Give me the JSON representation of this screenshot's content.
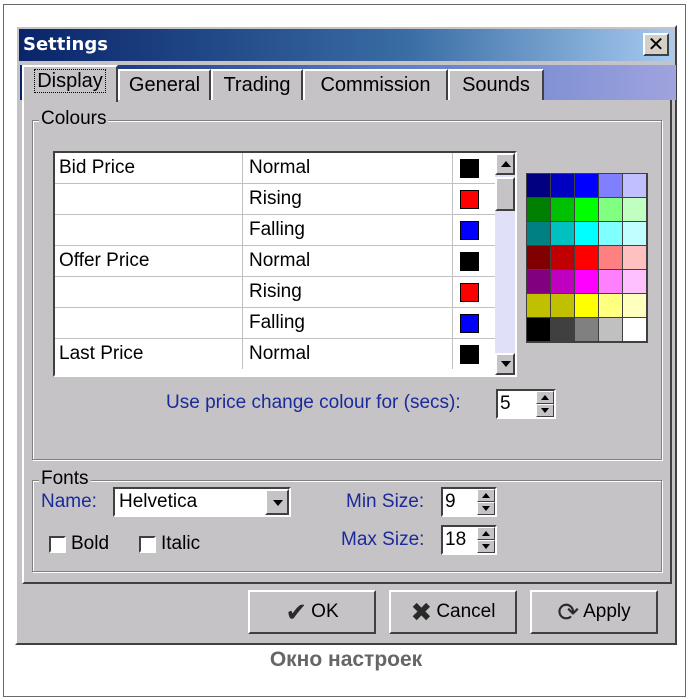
{
  "window": {
    "title": "Settings",
    "close_glyph": "✕"
  },
  "tabs": [
    {
      "label": "Display",
      "active": true
    },
    {
      "label": "General",
      "active": false
    },
    {
      "label": "Trading",
      "active": false
    },
    {
      "label": "Commission",
      "active": false
    },
    {
      "label": "Sounds",
      "active": false
    }
  ],
  "colours": {
    "group_label": "Colours",
    "rows": [
      {
        "item": "Bid Price",
        "state": "Normal",
        "color": "#000000"
      },
      {
        "item": "",
        "state": "Rising",
        "color": "#ff0000"
      },
      {
        "item": "",
        "state": "Falling",
        "color": "#0000ff"
      },
      {
        "item": "Offer Price",
        "state": "Normal",
        "color": "#000000"
      },
      {
        "item": "",
        "state": "Rising",
        "color": "#ff0000"
      },
      {
        "item": "",
        "state": "Falling",
        "color": "#0000ff"
      },
      {
        "item": "Last Price",
        "state": "Normal",
        "color": "#000000"
      }
    ],
    "palette": [
      [
        "#000080",
        "#0000c0",
        "#0000ff",
        "#8080ff",
        "#c0c0ff"
      ],
      [
        "#008000",
        "#00c000",
        "#00ff00",
        "#80ff80",
        "#c0ffc0"
      ],
      [
        "#008080",
        "#00c0c0",
        "#00ffff",
        "#80ffff",
        "#c0ffff"
      ],
      [
        "#800000",
        "#c00000",
        "#ff0000",
        "#ff8080",
        "#ffc0c0"
      ],
      [
        "#800080",
        "#c000c0",
        "#ff00ff",
        "#ff80ff",
        "#ffc0ff"
      ],
      [
        "#c0c000",
        "#c0c000",
        "#ffff00",
        "#ffff80",
        "#ffffc0"
      ],
      [
        "#000000",
        "#404040",
        "#808080",
        "#c0c0c0",
        "#ffffff"
      ]
    ],
    "price_change_label": "Use price change colour for (secs):",
    "price_change_secs": "5"
  },
  "fonts": {
    "group_label": "Fonts",
    "name_label": "Name:",
    "name_value": "Helvetica",
    "bold_label": "Bold",
    "italic_label": "Italic",
    "bold_checked": false,
    "italic_checked": false,
    "min_size_label": "Min Size:",
    "min_size_value": "9",
    "max_size_label": "Max Size:",
    "max_size_value": "18"
  },
  "buttons": {
    "ok_label": "OK",
    "cancel_label": "Cancel",
    "apply_label": "Apply"
  },
  "caption": "Окно настроек"
}
